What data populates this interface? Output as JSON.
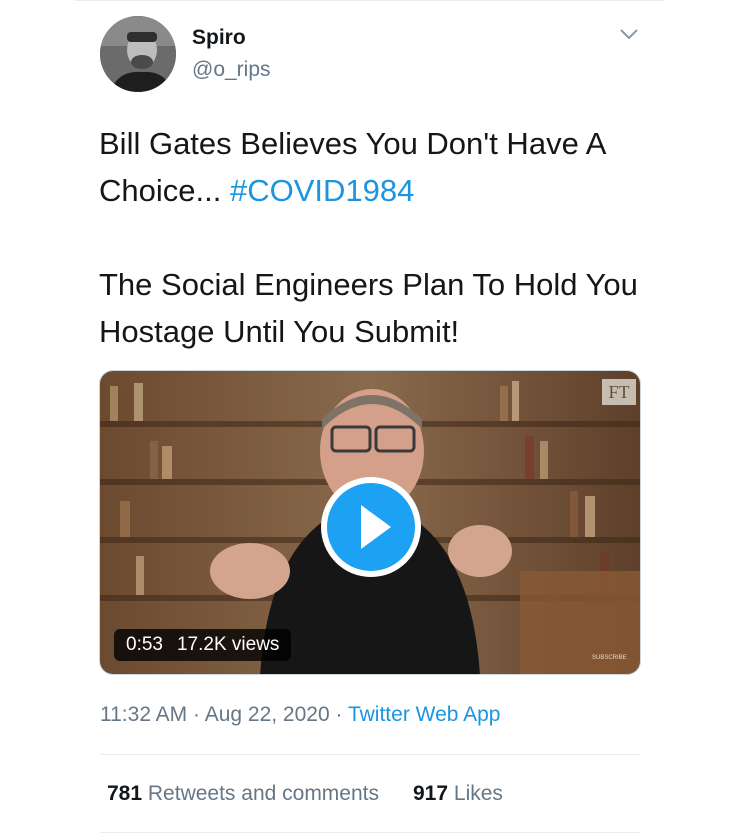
{
  "author": {
    "name": "Spiro",
    "handle": "@o_rips",
    "avatar_icon": "profile-photo-man"
  },
  "tweet": {
    "line1_text": "Bill Gates Believes You Don't Have A Choice... ",
    "hashtag": "#COVID1984",
    "paragraph2": "The Social Engineers Plan To Hold You Hostage Until You Submit!"
  },
  "video": {
    "duration": "0:53",
    "views": "17.2K views",
    "watermark": "FT",
    "play_icon": "play-icon"
  },
  "meta": {
    "time": "11:32 AM",
    "sep1": "·",
    "date": "Aug 22, 2020",
    "sep2": "·",
    "source": "Twitter Web App"
  },
  "stats": {
    "retweets_count": "781",
    "retweets_label": "Retweets and comments",
    "likes_count": "917",
    "likes_label": "Likes"
  },
  "colors": {
    "accent": "#1b95e0",
    "text": "#14171a",
    "muted": "#657786"
  }
}
